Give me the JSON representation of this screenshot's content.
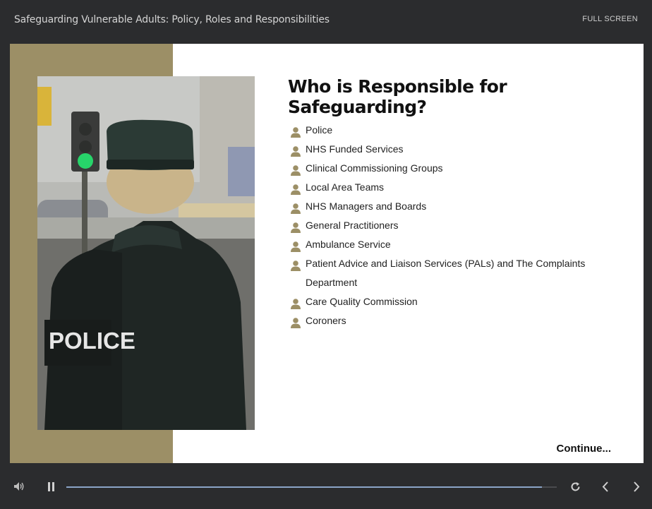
{
  "header": {
    "course_title": "Safeguarding Vulnerable Adults: Policy, Roles and Responsibilities",
    "fullscreen_label": "FULL SCREEN"
  },
  "slide": {
    "heading": "Who is Responsible for Safeguarding?",
    "image_text": "POLICE",
    "items": [
      "Police",
      "NHS Funded Services",
      "Clinical Commissioning Groups",
      "Local Area Teams",
      "NHS Managers and Boards",
      "General Practitioners",
      "Ambulance Service",
      "Patient Advice and Liaison Services (PALs) and The Complaints Department",
      "Care Quality Commission",
      "Coroners"
    ],
    "continue_label": "Continue..."
  },
  "player": {
    "progress_percent": 97,
    "icons": {
      "volume": "volume-icon",
      "pause": "pause-icon",
      "replay": "replay-icon",
      "prev": "chevron-left-icon",
      "next": "chevron-right-icon"
    }
  },
  "colors": {
    "accent_tan": "#9c8f66",
    "chrome": "#2b2c2e",
    "progress": "#8ba4c7"
  }
}
